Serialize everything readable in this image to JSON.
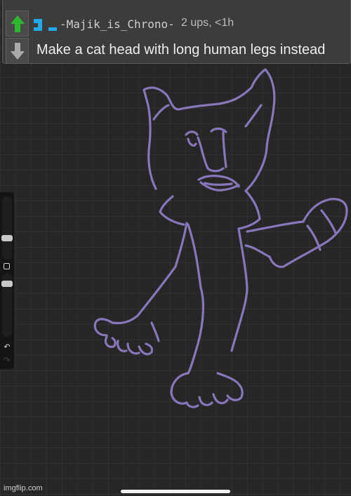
{
  "comment": {
    "username": "-Majik_is_Chrono-",
    "meta": "2 ups, <1h",
    "text": "Make a cat head with long human legs instead"
  },
  "icons": {
    "upvote": "upvote-arrow-icon",
    "downvote": "downvote-arrow-icon",
    "avatar": "user-avatar-icon",
    "undo": "undo-icon",
    "redo": "redo-icon"
  },
  "colors": {
    "upvote_active": "#2eb82e",
    "downvote": "#aaaaaa",
    "avatar": "#23a8e8",
    "stroke": "#8e7bc4"
  },
  "watermark": "imgflip.com"
}
